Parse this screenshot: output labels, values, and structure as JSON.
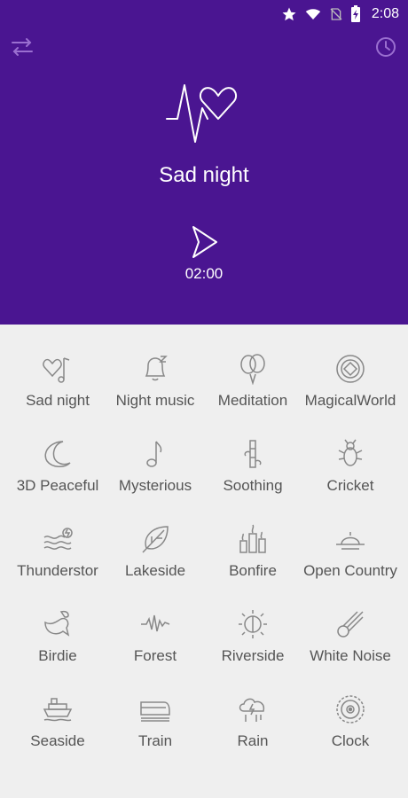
{
  "status_bar": {
    "time": "2:08",
    "icons": [
      "star-icon",
      "wifi-icon",
      "no-sim-icon",
      "battery-icon"
    ]
  },
  "header": {
    "background_color": "#4a1591",
    "title": "Sad night",
    "timer": "02:00",
    "left_button_icon": "shuffle-icon",
    "right_button_icon": "clock-icon",
    "logo_icon": "heartbeat-heart-icon",
    "play_icon": "play-icon"
  },
  "sounds": [
    {
      "label": "Sad night",
      "icon": "heart-music-icon"
    },
    {
      "label": "Night music",
      "icon": "bell-icon"
    },
    {
      "label": "Meditation",
      "icon": "balloons-icon"
    },
    {
      "label": "MagicalWorld",
      "icon": "compass-icon"
    },
    {
      "label": "3D Peaceful",
      "icon": "moon-icon"
    },
    {
      "label": "Mysterious",
      "icon": "music-note-icon"
    },
    {
      "label": "Soothing",
      "icon": "bamboo-icon"
    },
    {
      "label": "Cricket",
      "icon": "bug-icon"
    },
    {
      "label": "Thunderstor",
      "icon": "storm-waves-icon"
    },
    {
      "label": "Lakeside",
      "icon": "leaf-icon"
    },
    {
      "label": "Bonfire",
      "icon": "candles-icon"
    },
    {
      "label": "Open Country",
      "icon": "sunset-icon"
    },
    {
      "label": "Birdie",
      "icon": "bird-icon"
    },
    {
      "label": "Forest",
      "icon": "waveform-icon"
    },
    {
      "label": "Riverside",
      "icon": "sun-icon"
    },
    {
      "label": "White Noise",
      "icon": "comet-icon"
    },
    {
      "label": "Seaside",
      "icon": "ship-icon"
    },
    {
      "label": "Train",
      "icon": "train-icon"
    },
    {
      "label": "Rain",
      "icon": "rain-cloud-icon"
    },
    {
      "label": "Clock",
      "icon": "clock-face-icon"
    }
  ]
}
